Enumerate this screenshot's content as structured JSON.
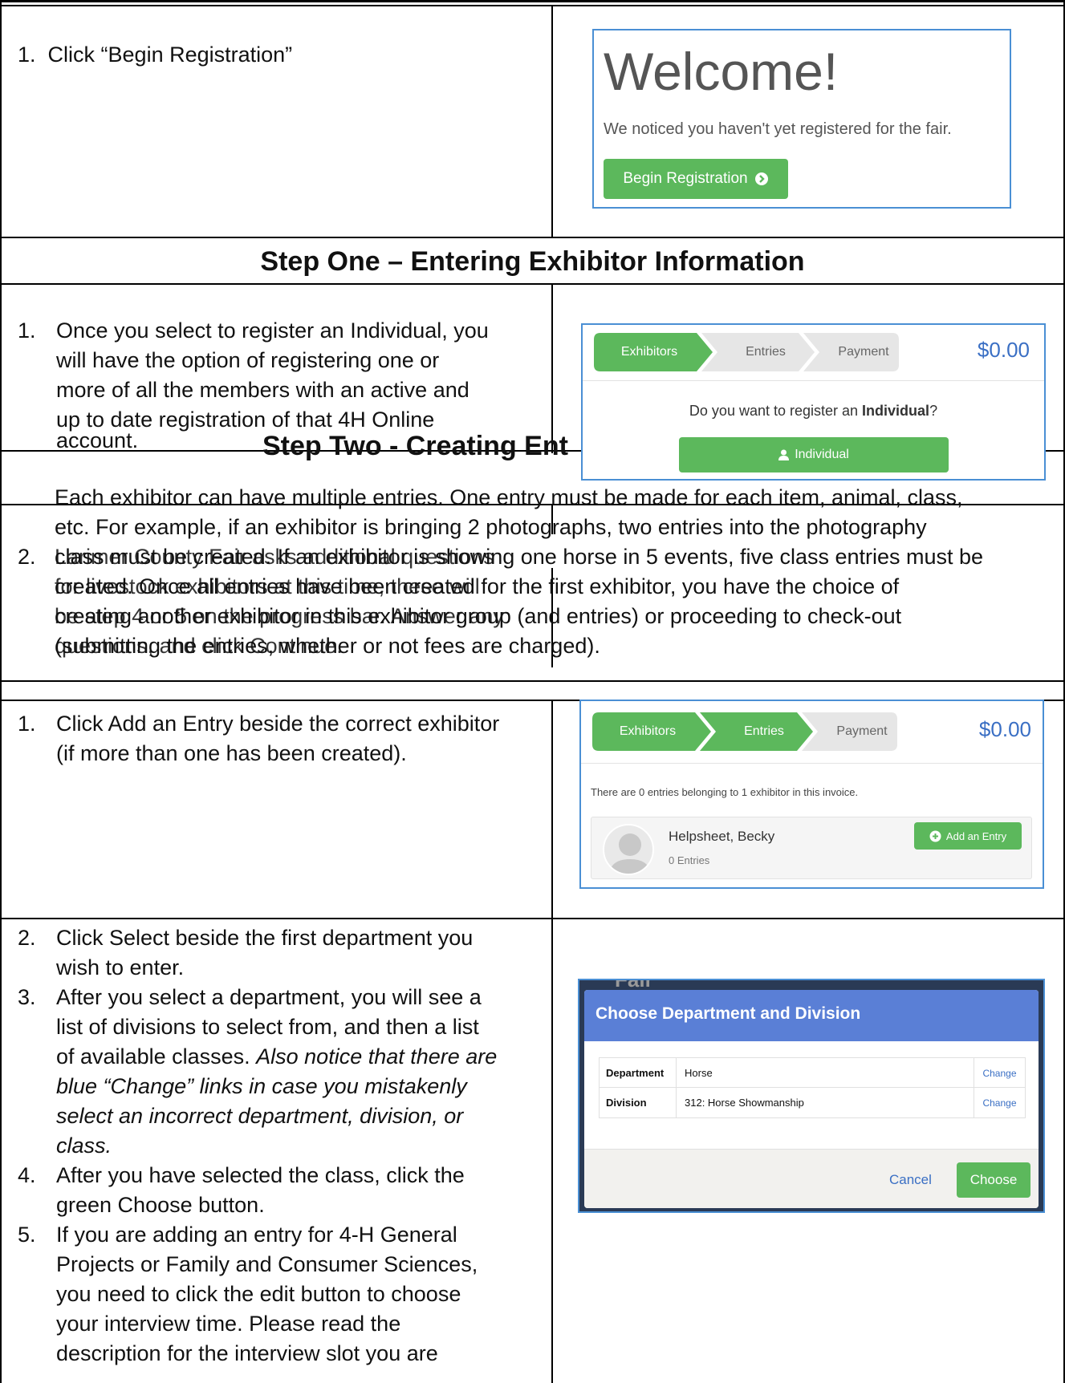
{
  "intro": {
    "step_number": "1.",
    "step_text": "Click “Begin Registration”",
    "welcome_title": "Welcome!",
    "welcome_text": "We noticed you haven't yet registered for the fair.",
    "begin_button": "Begin Registration"
  },
  "step_one": {
    "heading": "Step One – Entering Exhibitor Information",
    "item_number": "1.",
    "item_lines": [
      "Once you select to register an Individual, you",
      "will have the option of registering one or",
      "more of all the members with an active and",
      "up to date registration of that 4H Online",
      "account."
    ],
    "progress": {
      "stages": [
        "Exhibitors",
        "Entries",
        "Payment"
      ],
      "total": "$0.00"
    },
    "question_prefix": "Do you want to register an ",
    "question_bold": "Individual",
    "question_suffix": "?",
    "individual_button": "Individual"
  },
  "step_two": {
    "heading": "Step Two - Creating Ent",
    "paragraph_lines": [
      "Each exhibitor can have multiple entries. One entry must be made for each item, animal, class,",
      "etc. For example, if an exhibitor is bringing 2 photographs, two entries into the photography",
      "class must be created. If an exhibitor is showing one horse in 5 events, five class entries must be",
      "created. Once all entries have been created for the first exhibitor, you have the choice of",
      "creating another exhibitor in this exhibitor group (and entries) or proceeding to check-out",
      "(submitting the entries, whether or not fees are charged)."
    ],
    "overlap_number": "2.",
    "overlap_lines": [
      "Larimer County Fair asks additional questions",
      "for livestock exhibitors at this time, these will",
      "be step 4 or 5 on the progress bar. Answer any",
      "questions, and click Continue."
    ]
  },
  "entries_section": {
    "item_number": "1.",
    "item_lines": [
      "Click Add an Entry beside the correct exhibitor",
      "(if more than one has been created)."
    ],
    "progress": {
      "stages": [
        "Exhibitors",
        "Entries",
        "Payment"
      ],
      "total": "$0.00"
    },
    "info_text": "There are 0 entries belonging to 1 exhibitor in this invoice.",
    "exhibitor_name": "Helpsheet, Becky",
    "exhibitor_entries": "0 Entries",
    "add_entry_button": "Add an Entry"
  },
  "department_section": {
    "items": [
      {
        "number": "2.",
        "lines": [
          "Click Select beside the first department you",
          "wish to enter."
        ]
      },
      {
        "number": "3.",
        "lines": [
          "After you select a department, you will see a",
          "list of divisions to select from, and then a list"
        ],
        "italic_lines": [
          "of available classes. Also notice that there are",
          "blue “Change” links in case you mistakenly",
          "select an incorrect department, division, or",
          "class."
        ],
        "italic_start": "Also notice that there are"
      },
      {
        "number": "4.",
        "lines": [
          "After you have selected the class, click the",
          "green Choose button."
        ]
      },
      {
        "number": "5.",
        "lines": [
          "If you are adding an entry for 4-H General",
          "Projects or Family and Consumer Sciences,",
          "you need to click the edit button to choose",
          "your interview time.  Please read the",
          "description for the interview slot you are"
        ]
      }
    ],
    "modal": {
      "behind_text": "Fair",
      "title": "Choose Department and Division",
      "rows": [
        {
          "label": "Department",
          "value": "Horse",
          "link": "Change"
        },
        {
          "label": "Division",
          "value": "312: Horse Showmanship",
          "link": "Change"
        }
      ],
      "cancel": "Cancel",
      "choose": "Choose"
    }
  },
  "colors": {
    "green": "#5cb85c",
    "modal_blue": "#5a7fd6",
    "link_blue": "#3a6fc4",
    "grey_stage": "#e6e6e6",
    "frame_blue": "#4a8fd4"
  }
}
